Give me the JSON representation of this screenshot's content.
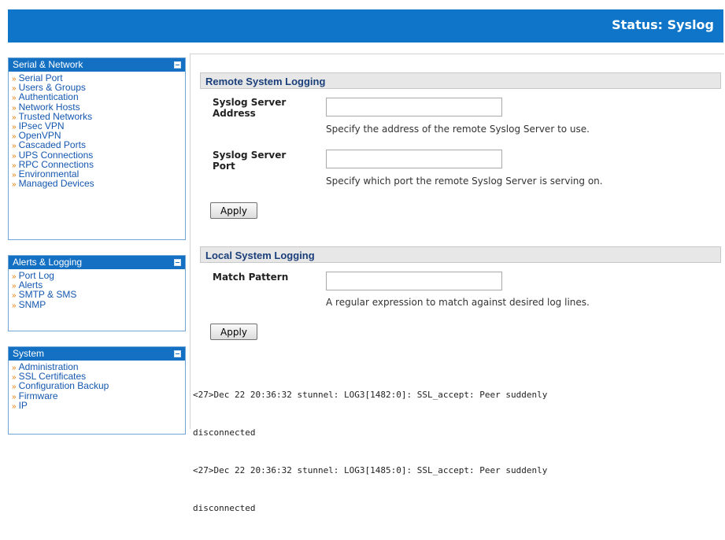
{
  "header": {
    "title": "Status: Syslog"
  },
  "sidebar": {
    "groups": [
      {
        "title": "Serial & Network",
        "items": [
          "Serial Port",
          "Users & Groups",
          "Authentication",
          "Network Hosts",
          "Trusted Networks",
          "IPsec VPN",
          "OpenVPN",
          "Cascaded Ports",
          "UPS Connections",
          "RPC Connections",
          "Environmental",
          "Managed Devices"
        ]
      },
      {
        "title": "Alerts & Logging",
        "items": [
          "Port Log",
          "Alerts",
          "SMTP & SMS",
          "SNMP"
        ]
      },
      {
        "title": "System",
        "items": [
          "Administration",
          "SSL Certificates",
          "Configuration Backup",
          "Firmware",
          "IP"
        ]
      }
    ],
    "arrow": "»"
  },
  "remote": {
    "heading": "Remote System Logging",
    "server_address_label": "Syslog Server Address",
    "server_address_value": "",
    "server_address_help": "Specify the address of the remote Syslog Server to use.",
    "server_port_label": "Syslog Server Port",
    "server_port_value": "",
    "server_port_help": "Specify which port the remote Syslog Server is serving on.",
    "apply_label": "Apply"
  },
  "local": {
    "heading": "Local System Logging",
    "match_label": "Match Pattern",
    "match_value": "",
    "match_help": "A regular expression to match against desired log lines.",
    "apply_label": "Apply"
  },
  "log_lines": [
    "<27>Dec 22 20:36:32 stunnel: LOG3[1482:0]: SSL_accept: Peer suddenly",
    "disconnected",
    "<27>Dec 22 20:36:32 stunnel: LOG3[1485:0]: SSL_accept: Peer suddenly",
    "disconnected"
  ],
  "colors": {
    "header_bg": "#0f75c9",
    "sidebar_bar": "#1470c2",
    "link": "#1457b0",
    "arrow": "#e07a00"
  }
}
